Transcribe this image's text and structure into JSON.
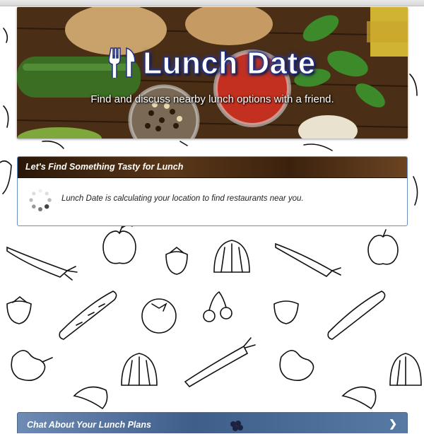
{
  "app": {
    "title": "Lunch Date",
    "subtitle": "Find and discuss nearby lunch options with a friend."
  },
  "location_panel": {
    "heading": "Let's Find Something Tasty for Lunch",
    "status_message": "Lunch Date is calculating your location to find restaurants near you."
  },
  "chat_panel": {
    "heading": "Chat About Your Lunch Plans",
    "expand_icon": "chevron-right-icon"
  },
  "colors": {
    "title_glow": "#2b3a8f",
    "panel_border": "#6a8fc2",
    "panel_header": "#4a2c12",
    "chat_header": "#4f6f98"
  }
}
